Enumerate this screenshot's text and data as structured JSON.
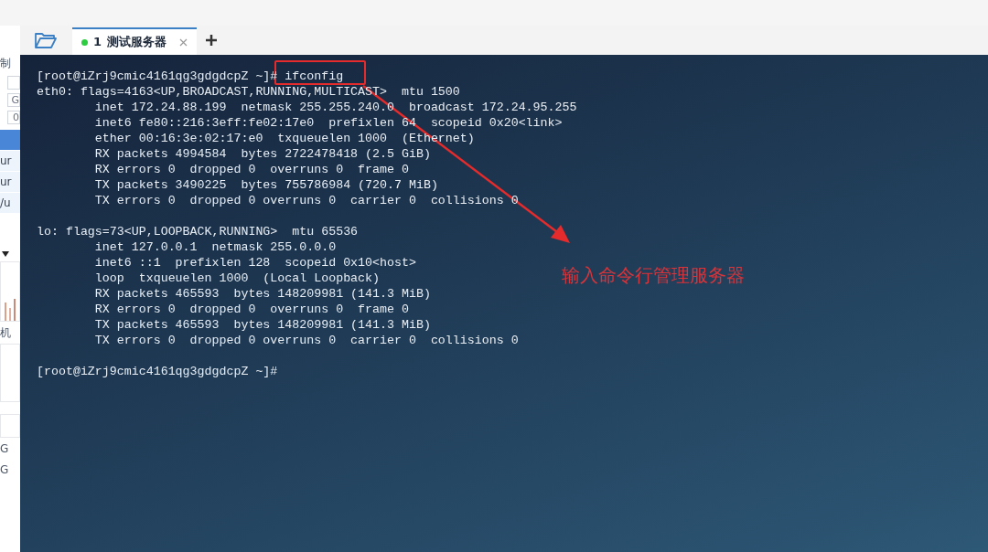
{
  "left_panel": {
    "fragments": [
      {
        "kind": "text",
        "text": "制"
      },
      {
        "kind": "field"
      },
      {
        "kind": "field",
        "text": "G"
      },
      {
        "kind": "field",
        "text": "0"
      },
      {
        "kind": "header"
      },
      {
        "kind": "list",
        "text": "ur"
      },
      {
        "kind": "list",
        "text": "ur"
      },
      {
        "kind": "list",
        "text": "/u"
      },
      {
        "kind": "text",
        "text": "机"
      },
      {
        "kind": "text",
        "text": "G"
      },
      {
        "kind": "text",
        "text": "G"
      }
    ]
  },
  "tabs": [
    {
      "number": "1",
      "label": "测试服务器",
      "selected": true,
      "connected": true
    }
  ],
  "terminal": {
    "blocks": [
      {
        "lines": [
          "[root@iZrj9cmic4161qg3gdgdcpZ ~]# ifconfig",
          "eth0: flags=4163<UP,BROADCAST,RUNNING,MULTICAST>  mtu 1500",
          "        inet 172.24.88.199  netmask 255.255.240.0  broadcast 172.24.95.255",
          "        inet6 fe80::216:3eff:fe02:17e0  prefixlen 64  scopeid 0x20<link>",
          "        ether 00:16:3e:02:17:e0  txqueuelen 1000  (Ethernet)",
          "        RX packets 4994584  bytes 2722478418 (2.5 GiB)",
          "        RX errors 0  dropped 0  overruns 0  frame 0",
          "        TX packets 3490225  bytes 755786984 (720.7 MiB)",
          "        TX errors 0  dropped 0 overruns 0  carrier 0  collisions 0"
        ]
      },
      {
        "lines": [
          "lo: flags=73<UP,LOOPBACK,RUNNING>  mtu 65536",
          "        inet 127.0.0.1  netmask 255.0.0.0",
          "        inet6 ::1  prefixlen 128  scopeid 0x10<host>",
          "        loop  txqueuelen 1000  (Local Loopback)",
          "        RX packets 465593  bytes 148209981 (141.3 MiB)",
          "        RX errors 0  dropped 0  overruns 0  frame 0",
          "        TX packets 465593  bytes 148209981 (141.3 MiB)",
          "        TX errors 0  dropped 0 overruns 0  carrier 0  collisions 0"
        ]
      },
      {
        "lines": [
          "[root@iZrj9cmic4161qg3gdgdcpZ ~]#"
        ]
      }
    ]
  },
  "annotation": {
    "caption": "输入命令行管理服务器"
  }
}
